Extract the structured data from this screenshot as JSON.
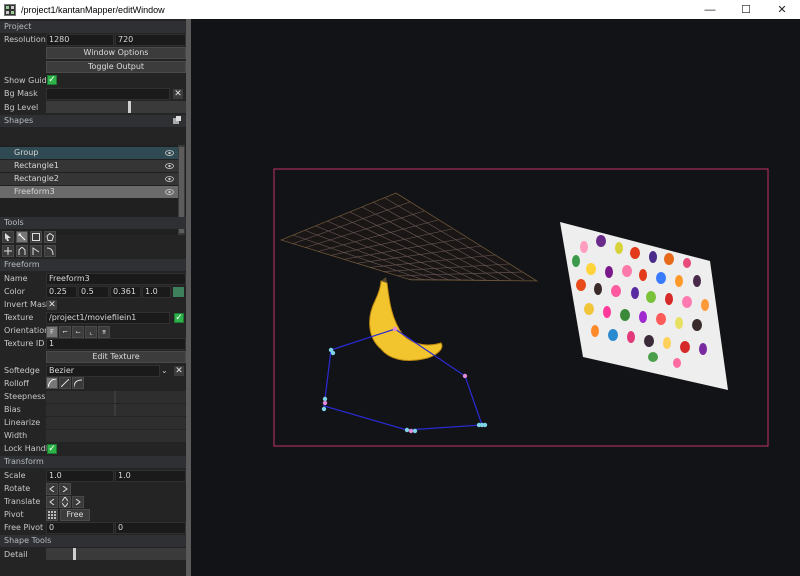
{
  "window": {
    "title": "/project1/kantanMapper/editWindow",
    "minimize": "—",
    "maximize": "☐",
    "close": "✕"
  },
  "project": {
    "header": "Project",
    "resolution_label": "Resolution",
    "res_w": "1280",
    "res_h": "720",
    "window_options": "Window Options",
    "toggle_output": "Toggle Output",
    "show_guide_label": "Show Guide",
    "bg_mask_label": "Bg Mask",
    "bg_level_label": "Bg Level",
    "bg_level_value": 0.6
  },
  "shapes": {
    "header": "Shapes",
    "items": [
      {
        "label": "Group",
        "selected": false,
        "group": true
      },
      {
        "label": "Rectangle1",
        "selected": false,
        "group": false
      },
      {
        "label": "Rectangle2",
        "selected": false,
        "group": false
      },
      {
        "label": "Freeform3",
        "selected": true,
        "group": false
      }
    ]
  },
  "tools": {
    "header": "Tools",
    "icons": [
      "select-arrow-icon",
      "multi-select-icon",
      "rectangle-tool-icon",
      "circle-tool-icon",
      "add-point-icon",
      "edit-point-icon",
      "bezier-point-icon",
      "curve-tool-icon"
    ]
  },
  "freeform": {
    "header": "Freeform",
    "name_label": "Name",
    "name_value": "Freeform3",
    "color_label": "Color",
    "color_r": "0.25",
    "color_g": "0.5",
    "color_b": "0.361",
    "color_a": "1.0",
    "swatch": "#3f805c",
    "invert_mask_label": "Invert Mask",
    "texture_label": "Texture",
    "texture_value": "/project1/moviefilein1",
    "orientation_label": "Orientation",
    "orientation_options": [
      "F",
      "⌐",
      "⌙",
      "⌞",
      "⌆"
    ],
    "texture_id_label": "Texture ID",
    "texture_id_value": "1",
    "edit_texture": "Edit Texture",
    "softedge_label": "Softedge",
    "softedge_value": "Bezier",
    "rolloff_label": "Rolloff",
    "steepness_label": "Steepness",
    "bias_label": "Bias",
    "linearize_label": "Linearize",
    "width_label": "Width",
    "lock_handle_label": "Lock Handle"
  },
  "transform": {
    "header": "Transform",
    "scale_label": "Scale",
    "scale_x": "1.0",
    "scale_y": "1.0",
    "rotate_label": "Rotate",
    "translate_label": "Translate",
    "pivot_label": "Pivot",
    "pivot_free": "Free",
    "free_pivot_label": "Free Pivot",
    "free_pivot_x": "0",
    "free_pivot_y": "0"
  },
  "shape_tools": {
    "header": "Shape Tools",
    "detail_label": "Detail",
    "detail_value": 0.2
  },
  "colors": {
    "guide_rect": "#c0306a",
    "freeform_stroke": "#2b2bd6",
    "handle_pink": "#e08ad8",
    "handle_cyan": "#7fd3e6",
    "check_green": "#2db34a"
  }
}
